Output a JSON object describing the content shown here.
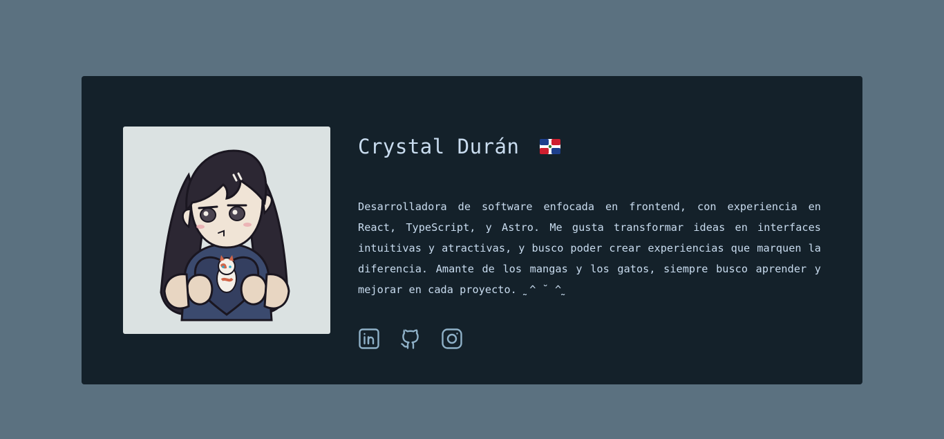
{
  "profile": {
    "name": "Crystal Durán",
    "bio": "Desarrolladora de software enfocada en frontend, con experiencia en React, TypeScript, y Astro. Me gusta transformar ideas en interfaces intuitivas y atractivas, y busco poder crear experiencias que marquen la diferencia. Amante de los mangas y los gatos, siempre busco aprender y mejorar en cada proyecto. ˷^ ˘ ^˷",
    "flag_icon": "dominican-republic-flag-icon",
    "avatar_icon": "anime-girl-with-cat-illustration"
  },
  "socials": [
    {
      "name": "LinkedIn",
      "icon": "linkedin-icon"
    },
    {
      "name": "GitHub",
      "icon": "github-icon"
    },
    {
      "name": "Instagram",
      "icon": "instagram-icon"
    }
  ],
  "colors": {
    "page_background": "#5b7180",
    "card_background": "#14212a",
    "text": "#c9dcef",
    "icon": "#8fb1c8",
    "avatar_background": "#dbe2e2"
  }
}
